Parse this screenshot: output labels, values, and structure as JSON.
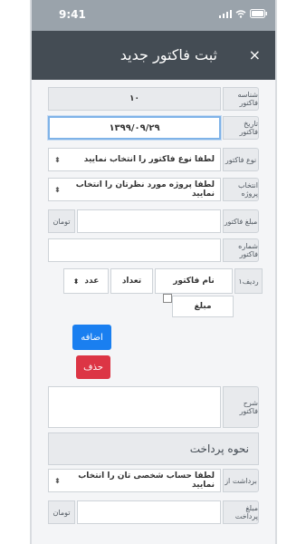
{
  "status": {
    "time": "9:41"
  },
  "header": {
    "title": "ثبت فاکتور جدید",
    "close": "×"
  },
  "form": {
    "invoice_id": {
      "label": "شناسه فاکتور",
      "value": "۱۰"
    },
    "invoice_date": {
      "label": "تاریخ فاکتور",
      "value": "۱۳۹۹/۰۹/۲۹"
    },
    "invoice_type": {
      "label": "نوع فاکتور",
      "value": "لطفا نوع فاکتور را انتخاب نمایید"
    },
    "project": {
      "label": "انتخاب پروژه",
      "value": "لطفا پروژه مورد نظرتان را انتخاب نمایید"
    },
    "amount": {
      "label": "مبلغ فاکتور",
      "value": "",
      "suffix": "تومان"
    },
    "invoice_number": {
      "label": "شماره فاکتور",
      "value": ""
    },
    "item_row": {
      "label": "ردیف۱",
      "name_placeholder": "نام فاکتور",
      "count_placeholder": "تعداد",
      "unit": "عدد",
      "price_placeholder": "مبلغ"
    },
    "add_button": "اضافه",
    "delete_button": "حذف",
    "description": {
      "label": "شرح فاکتور",
      "value": ""
    }
  },
  "payment": {
    "section_title": "نحوه پرداخت",
    "withdraw_from": {
      "label": "برداشت از",
      "value": "لطفا حساب شخصی تان را انتخاب نمایید"
    },
    "amount": {
      "label": "مبلغ پرداخت",
      "value": "",
      "suffix": "تومان"
    }
  },
  "colors": {
    "header": "#444c54",
    "add": "#1a7ff0",
    "delete": "#dc3545"
  }
}
